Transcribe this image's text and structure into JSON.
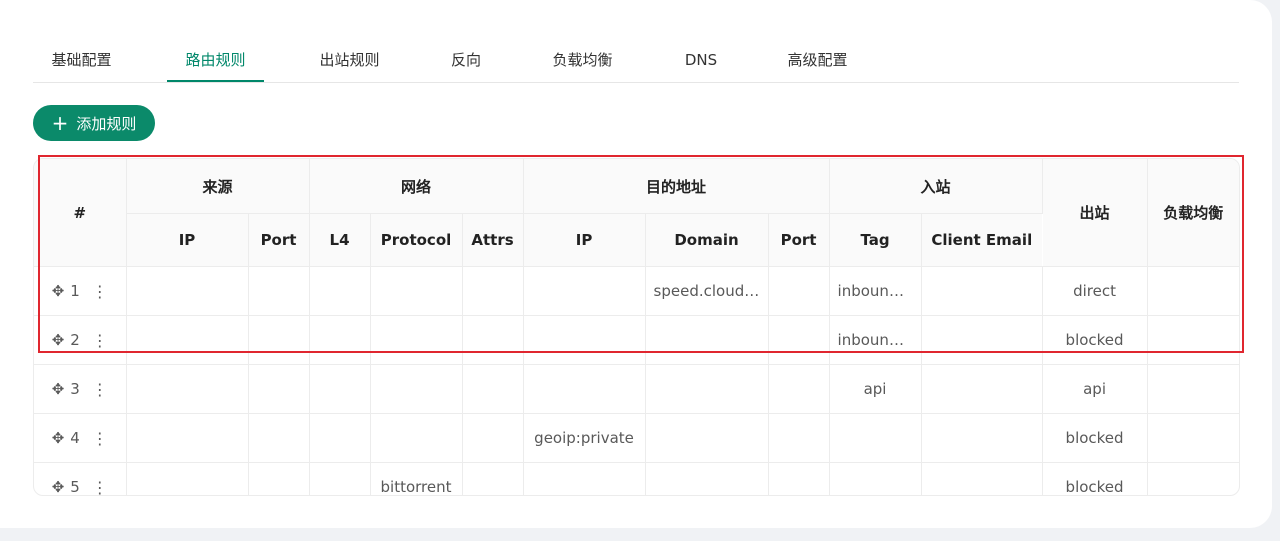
{
  "tabs": [
    {
      "label": "基础配置",
      "active": false
    },
    {
      "label": "路由规则",
      "active": true
    },
    {
      "label": "出站规则",
      "active": false
    },
    {
      "label": "反向",
      "active": false
    },
    {
      "label": "负载均衡",
      "active": false
    },
    {
      "label": "DNS",
      "active": false
    },
    {
      "label": "高级配置",
      "active": false
    }
  ],
  "add_button": {
    "icon": "plus-icon",
    "label": "添加规则"
  },
  "table": {
    "header_groups": {
      "index": "#",
      "source": "来源",
      "network": "网络",
      "destination": "目的地址",
      "inbound": "入站",
      "outbound": "出站",
      "balancer": "负载均衡"
    },
    "sub_headers": {
      "source_ip": "IP",
      "source_port": "Port",
      "l4": "L4",
      "protocol": "Protocol",
      "attrs": "Attrs",
      "dest_ip": "IP",
      "domain": "Domain",
      "dest_port": "Port",
      "tag": "Tag",
      "client_email": "Client Email"
    },
    "rows": [
      {
        "index": "1",
        "source_ip": "",
        "source_port": "",
        "l4": "",
        "protocol": "",
        "attrs": "",
        "dest_ip": "",
        "domain": "speed.cloudfl...",
        "dest_port": "",
        "tag": "inbound...",
        "client_email": "",
        "outbound": "direct",
        "balancer": ""
      },
      {
        "index": "2",
        "source_ip": "",
        "source_port": "",
        "l4": "",
        "protocol": "",
        "attrs": "",
        "dest_ip": "",
        "domain": "",
        "dest_port": "",
        "tag": "inbound...",
        "client_email": "",
        "outbound": "blocked",
        "balancer": ""
      },
      {
        "index": "3",
        "source_ip": "",
        "source_port": "",
        "l4": "",
        "protocol": "",
        "attrs": "",
        "dest_ip": "",
        "domain": "",
        "dest_port": "",
        "tag": "api",
        "client_email": "",
        "outbound": "api",
        "balancer": ""
      },
      {
        "index": "4",
        "source_ip": "",
        "source_port": "",
        "l4": "",
        "protocol": "",
        "attrs": "",
        "dest_ip": "geoip:private",
        "domain": "",
        "dest_port": "",
        "tag": "",
        "client_email": "",
        "outbound": "blocked",
        "balancer": ""
      },
      {
        "index": "5",
        "source_ip": "",
        "source_port": "",
        "l4": "",
        "protocol": "bittorrent",
        "attrs": "",
        "dest_ip": "",
        "domain": "",
        "dest_port": "",
        "tag": "",
        "client_email": "",
        "outbound": "blocked",
        "balancer": ""
      }
    ],
    "row_icons": {
      "move": "drag-move-icon",
      "more": "more-vertical-icon"
    }
  },
  "colors": {
    "accent": "#00876a",
    "button": "#0b8a6a",
    "highlight": "#e0262f"
  }
}
